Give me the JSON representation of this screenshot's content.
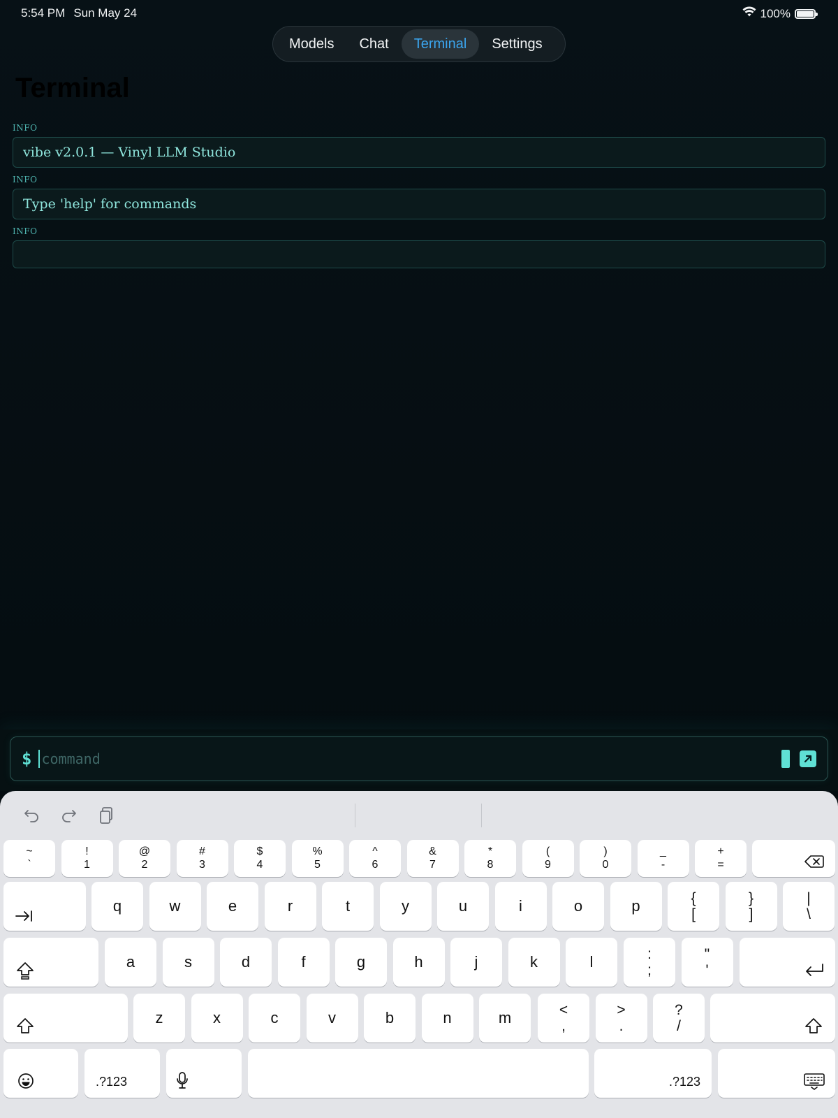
{
  "status_bar": {
    "time": "5:54 PM",
    "date": "Sun May 24",
    "battery": "100%",
    "wifi_icon": "wifi-icon",
    "battery_icon": "battery-icon"
  },
  "tabs": [
    {
      "label": "Models",
      "active": false
    },
    {
      "label": "Chat",
      "active": false
    },
    {
      "label": "Terminal",
      "active": true
    },
    {
      "label": "Settings",
      "active": false
    }
  ],
  "page_title": "Terminal",
  "log": [
    {
      "level": "INFO",
      "message": "vibe v2.0.1 — Vinyl LLM Studio"
    },
    {
      "level": "INFO",
      "message": "Type 'help' for commands"
    },
    {
      "level": "INFO",
      "message": ""
    }
  ],
  "command": {
    "prompt": "$",
    "placeholder": "command",
    "value": ""
  },
  "keyboard": {
    "toolbar": [
      "undo-icon",
      "redo-icon",
      "clipboard-icon"
    ],
    "row1": [
      {
        "top": "~",
        "bot": "`"
      },
      {
        "top": "!",
        "bot": "1"
      },
      {
        "top": "@",
        "bot": "2"
      },
      {
        "top": "#",
        "bot": "3"
      },
      {
        "top": "$",
        "bot": "4"
      },
      {
        "top": "%",
        "bot": "5"
      },
      {
        "top": "^",
        "bot": "6"
      },
      {
        "top": "&",
        "bot": "7"
      },
      {
        "top": "*",
        "bot": "8"
      },
      {
        "top": "(",
        "bot": "9"
      },
      {
        "top": ")",
        "bot": "0"
      },
      {
        "top": "_",
        "bot": "-"
      },
      {
        "top": "+",
        "bot": "="
      }
    ],
    "row2": [
      "q",
      "w",
      "e",
      "r",
      "t",
      "y",
      "u",
      "i",
      "o",
      "p"
    ],
    "row2_brackets": [
      {
        "top": "{",
        "bot": "["
      },
      {
        "top": "}",
        "bot": "]"
      },
      {
        "top": "|",
        "bot": "\\"
      }
    ],
    "row3": [
      "a",
      "s",
      "d",
      "f",
      "g",
      "h",
      "j",
      "k",
      "l"
    ],
    "row3_punct": [
      {
        "top": ":",
        "bot": ";"
      },
      {
        "top": "\"",
        "bot": "'"
      }
    ],
    "row4": [
      "z",
      "x",
      "c",
      "v",
      "b",
      "n",
      "m"
    ],
    "row4_punct": [
      {
        "top": "<",
        "bot": ","
      },
      {
        "top": ">",
        "bot": "."
      },
      {
        "top": "?",
        "bot": "/"
      }
    ],
    "numbers_label": ".?123",
    "colors": {
      "accent": "#5fe0d4",
      "tab_active": "#3ba5ee"
    }
  }
}
